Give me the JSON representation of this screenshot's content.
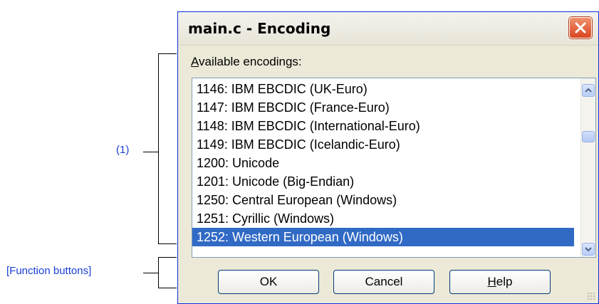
{
  "annotations": {
    "list_callout": "(1)",
    "buttons_callout": "[Function buttons]"
  },
  "dialog": {
    "title": "main.c - Encoding",
    "close_icon": "close-icon",
    "group_label": "Available encodings:",
    "encodings": [
      "1146: IBM EBCDIC (UK-Euro)",
      "1147: IBM EBCDIC (France-Euro)",
      "1148: IBM EBCDIC (International-Euro)",
      "1149: IBM EBCDIC (Icelandic-Euro)",
      "1200: Unicode",
      "1201: Unicode (Big-Endian)",
      "1250: Central European (Windows)",
      "1251: Cyrillic (Windows)",
      "1252: Western European (Windows)"
    ],
    "selected_index": 8,
    "buttons": {
      "ok": "OK",
      "cancel": "Cancel",
      "help": "Help"
    }
  },
  "colors": {
    "selection": "#316ac5",
    "callout_text": "#1a3fd6",
    "close_button": "#d8461f"
  }
}
